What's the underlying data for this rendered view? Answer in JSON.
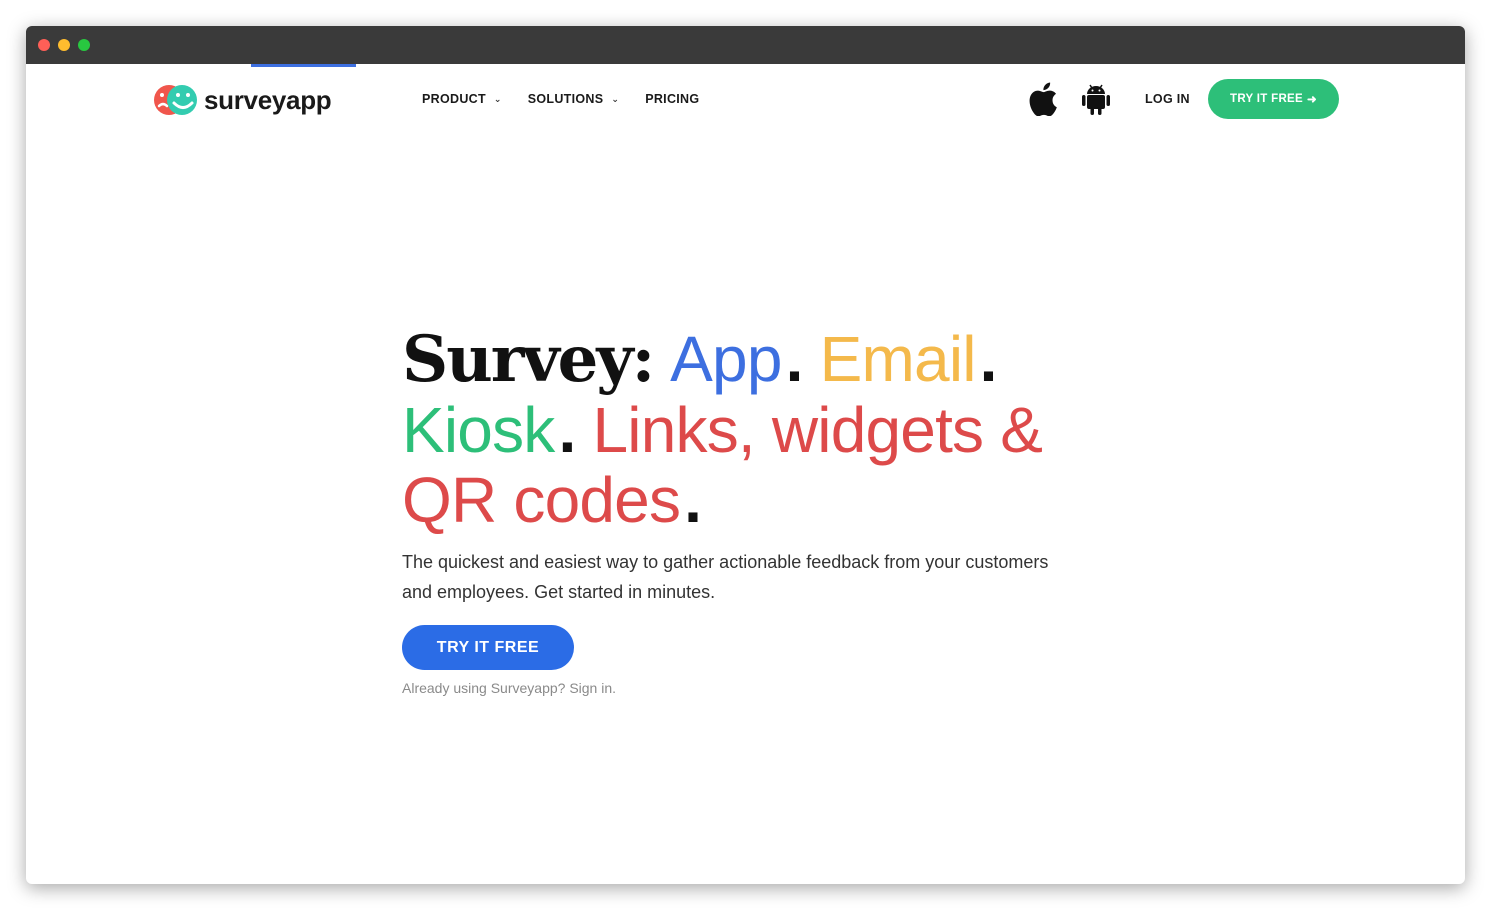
{
  "brand": {
    "name": "surveyapp",
    "colors": {
      "red": "#f0564c",
      "teal": "#33ccb0",
      "primary_blue": "#2b6ce6",
      "green": "#2dbf79"
    }
  },
  "nav": {
    "items": [
      {
        "label": "PRODUCT",
        "has_dropdown": true,
        "icon": "chevron-down-icon"
      },
      {
        "label": "SOLUTIONS",
        "has_dropdown": true,
        "icon": "chevron-down-icon"
      },
      {
        "label": "PRICING",
        "has_dropdown": false
      }
    ],
    "icons": [
      "apple-icon",
      "android-icon"
    ],
    "login_label": "LOG IN",
    "cta_label": "TRY IT FREE",
    "cta_arrow": "➜"
  },
  "hero": {
    "headline": {
      "prefix": "Survey:",
      "app": "App",
      "email": "Email",
      "kiosk": "Kiosk",
      "links": "Links, widgets &",
      "qr": "QR codes",
      "dot": "."
    },
    "subtext": "The quickest and easiest way to gather actionable feedback from your customers and employees. Get started in minutes.",
    "cta_label": "TRY IT FREE",
    "signin_text": "Already using Surveyapp? Sign in."
  }
}
